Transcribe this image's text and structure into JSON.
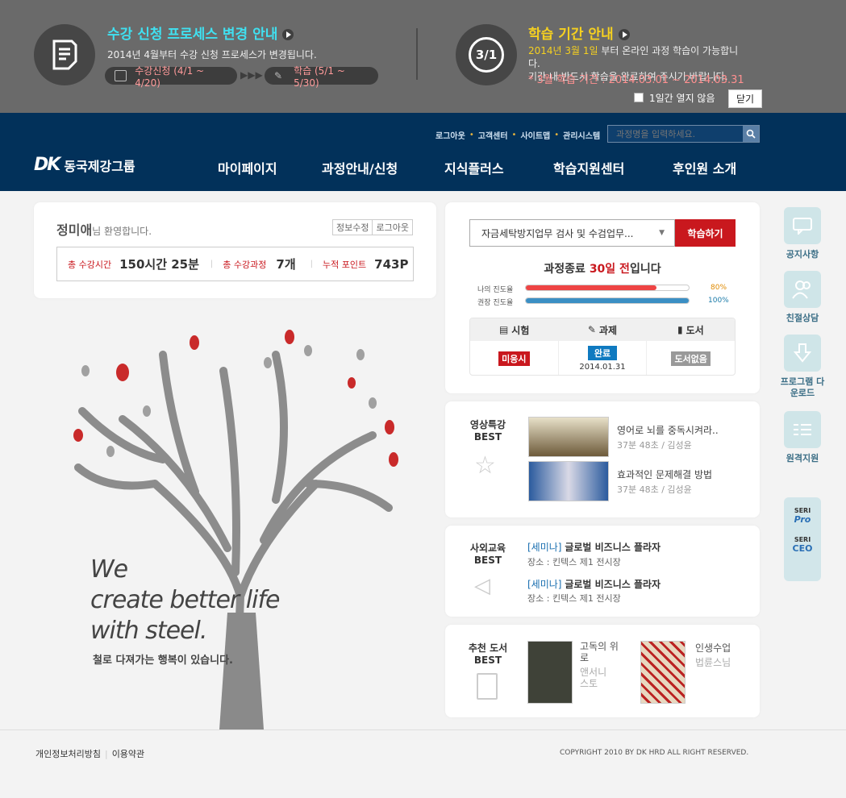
{
  "banner": {
    "left": {
      "title": "수강 신청 프로세스 변경 안내",
      "desc": "2014년 4월부터 수강 신청 프로세스가 변경됩니다.",
      "step1": "수강신청 (4/1 ~ 4/20)",
      "step2": "학습 (5/1 ~ 5/30)"
    },
    "right": {
      "icon_text": "3/1",
      "title": "학습 기간 안내",
      "highlight": "2014년 3월 1일",
      "line1_rest": " 부터 온라인 과정 학습이 가능합니다.",
      "line2": "기간 내 반드시 학습을 완료하여 주시기 바랍니다.",
      "line3": "* 3월 학습 기간 : 2014.03.01 ~ 2014.03.31"
    },
    "dont_show": "1일간 열지 않음",
    "close": "닫기"
  },
  "header": {
    "logo_mark": "DK",
    "logo_text": "동국제강그룹",
    "util": [
      "로그아웃",
      "고객센터",
      "사이트맵",
      "관리시스템"
    ],
    "search_placeholder": "과정명을 입력하세요.",
    "nav": [
      "마이페이지",
      "과정안내/신청",
      "지식플러스",
      "학습지원센터",
      "후인원 소개"
    ]
  },
  "user": {
    "name": "정미애",
    "suffix": "님 환영합니다.",
    "edit": "정보수정",
    "logout": "로그아웃",
    "stats": [
      {
        "label": "총 수강시간",
        "value": "150시간 25분"
      },
      {
        "label": "총 수강과정",
        "value": "7개"
      },
      {
        "label": "누적 포인트",
        "value": "743P"
      }
    ]
  },
  "hero": {
    "line1": "We",
    "line2": "create better life",
    "line3": "with steel.",
    "sub": "철로 다져가는 행복이 있습니다."
  },
  "study": {
    "course": "자금세탁방지업무 검사 및 수검업무...",
    "start": "학습하기",
    "deadline_pre": "과정종료 ",
    "deadline_days": "30일 전",
    "deadline_post": "입니다",
    "my_label": "나의 진도율",
    "my_value": "80%",
    "rec_label": "권장 진도율",
    "rec_value": "100%",
    "progress": {
      "mine": 0.8,
      "recommended": 1.0
    },
    "table": {
      "headers": [
        "시험",
        "과제",
        "도서"
      ],
      "exam": "미응시",
      "task": "완료",
      "task_date": "2014.01.31",
      "book": "도서없음"
    }
  },
  "video": {
    "label1": "영상특강",
    "label2": "BEST",
    "items": [
      {
        "title": "영어로 뇌를 중독시켜라..",
        "meta": "37분 48초  /  김성윤"
      },
      {
        "title": "효과적인 문제해결 방법",
        "meta": "37분 48초  /  김성윤"
      }
    ]
  },
  "edu": {
    "label1": "사외교육",
    "label2": "BEST",
    "items": [
      {
        "tag": "[세미나]",
        "title": "글로벌 비즈니스 플라자",
        "meta": "장소 : 킨텍스 제1 전시장"
      },
      {
        "tag": "[세미나]",
        "title": "글로벌 비즈니스 플라자",
        "meta": "장소 : 킨텍스 제1 전시장"
      }
    ]
  },
  "books": {
    "label1": "추천 도서",
    "label2": "BEST",
    "items": [
      {
        "title": "고독의 위로",
        "author": "앤서니 스토"
      },
      {
        "title": "인생수업",
        "author": "법륜스님"
      }
    ]
  },
  "quick": [
    "공지사항",
    "친절상담",
    "프로그램 다운로드",
    "원격지원"
  ],
  "seri": [
    "SERI",
    "Pro",
    "SERI",
    "CEO"
  ],
  "footer": {
    "privacy": "개인정보처리방침",
    "terms": "이용약관",
    "copyright": "COPYRIGHT 2010 BY DK HRD ALL RIGHT RESERVED."
  },
  "colors": {
    "banner": "#6a6a6a",
    "header": "#02315a",
    "accent_red": "#c9181e",
    "cyan": "#40e0f0",
    "yellow": "#f5d020"
  }
}
